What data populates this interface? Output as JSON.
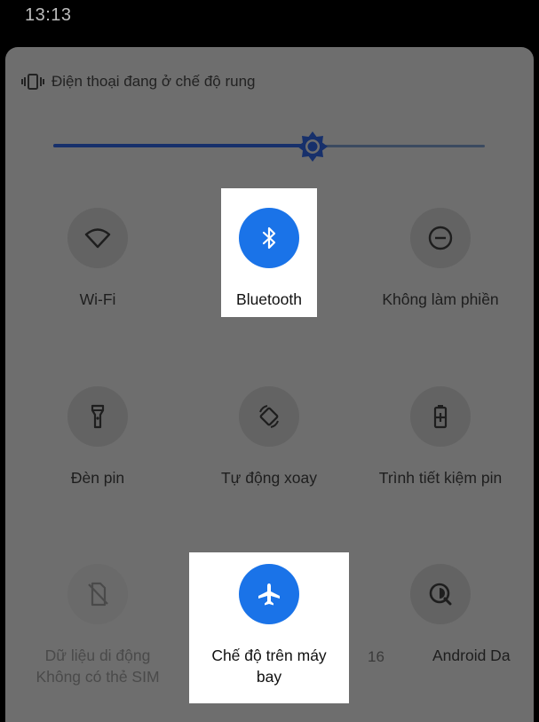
{
  "status_bar": {
    "time": "13:13"
  },
  "ringer": {
    "text": "Điện thoại đang ở chế độ rung",
    "icon": "vibrate-icon"
  },
  "brightness": {
    "level_percent": 60,
    "icon": "brightness-icon"
  },
  "tiles": {
    "wifi": {
      "label": "Wi-Fi",
      "icon": "wifi-icon",
      "active": false
    },
    "bluetooth": {
      "label": "Bluetooth",
      "icon": "bluetooth-icon",
      "active": true
    },
    "dnd": {
      "label": "Không làm phiền",
      "icon": "do-not-disturb-icon",
      "active": false
    },
    "flashlight": {
      "label": "Đèn pin",
      "icon": "flashlight-icon",
      "active": false
    },
    "autorotate": {
      "label": "Tự động xoay",
      "icon": "auto-rotate-icon",
      "active": false
    },
    "battery_saver": {
      "label": "Trình tiết kiệm pin",
      "icon": "battery-saver-icon",
      "active": false
    },
    "mobile_data": {
      "label": "Dữ liệu di động",
      "sublabel": "Không có thẻ SIM",
      "icon": "no-sim-icon",
      "active": false
    },
    "airplane": {
      "label_line1": "Chế độ trên máy",
      "label_line2": "bay",
      "icon": "airplane-icon",
      "active": true
    },
    "android_dark": {
      "label": "Android Da",
      "icon": "dark-theme-icon",
      "active": false
    }
  },
  "page_indicator": "16",
  "colors": {
    "panel": "#6e6e6e",
    "active": "#1a73e8",
    "tile_bg": "#636363",
    "highlight": "#ffffff"
  }
}
